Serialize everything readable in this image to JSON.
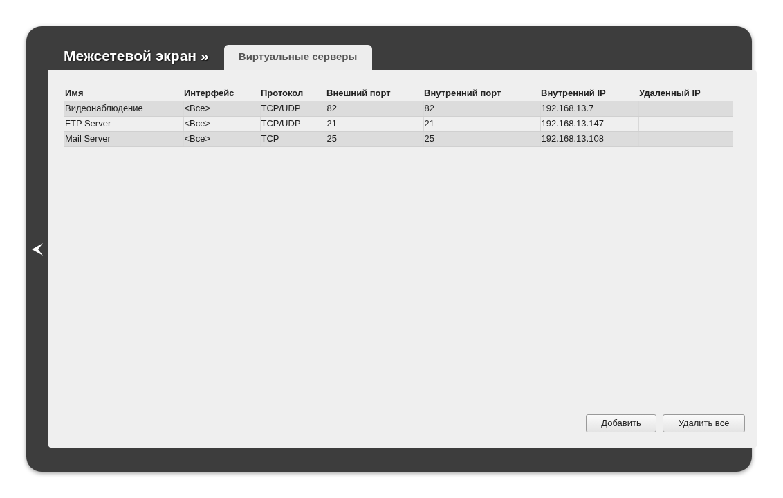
{
  "header": {
    "title": "Межсетевой экран »",
    "tabs": [
      {
        "label": "Виртуальные серверы",
        "selected": true
      }
    ]
  },
  "table": {
    "columns": [
      "Имя",
      "Интерфейс",
      "Протокол",
      "Внешний порт",
      "Внутренний порт",
      "Внутренний IP",
      "Удаленный IP"
    ],
    "rows": [
      [
        "Видеонаблюдение",
        "<Все>",
        "TCP/UDP",
        "82",
        "82",
        "192.168.13.7",
        ""
      ],
      [
        "FTP Server",
        "<Все>",
        "TCP/UDP",
        "21",
        "21",
        "192.168.13.147",
        ""
      ],
      [
        "Mail Server",
        "<Все>",
        "TCP",
        "25",
        "25",
        "192.168.13.108",
        ""
      ]
    ]
  },
  "buttons": [
    "Добавить",
    "Удалить все"
  ]
}
